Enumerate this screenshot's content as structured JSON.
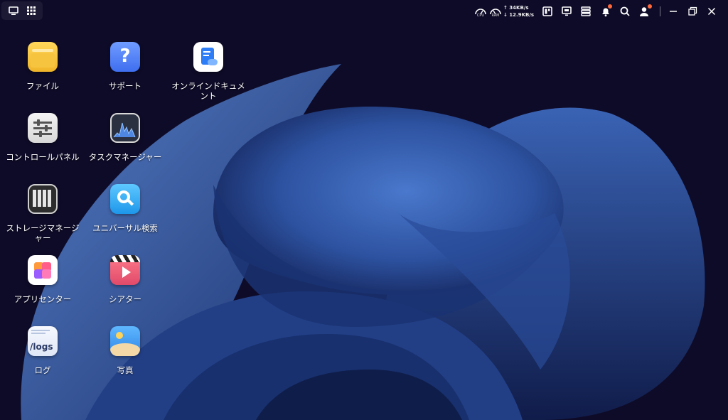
{
  "topbar": {
    "left_icons": [
      "desktop-icon",
      "apps-grid-icon"
    ],
    "meters": [
      {
        "label": "CPU",
        "icon": "cpu-gauge-icon"
      },
      {
        "label": "RAM",
        "icon": "ram-gauge-icon"
      }
    ],
    "network": {
      "upload": "↑ 34KB/s",
      "download": "↓ 12.9KB/s"
    },
    "right_icons": [
      "widget-icon",
      "monitor-icon",
      "server-list-icon",
      "bell-icon",
      "search-icon",
      "user-icon",
      "minimize-icon",
      "restore-icon",
      "close-icon"
    ],
    "notification_color": "#ff6a3d"
  },
  "desktop": {
    "items": [
      {
        "label": "ファイル",
        "icon": "folder-icon"
      },
      {
        "label": "サポート",
        "icon": "help-icon"
      },
      {
        "label": "オンラインドキュメント",
        "icon": "online-doc-icon"
      },
      {
        "label": "コントロールパネル",
        "icon": "control-panel-icon"
      },
      {
        "label": "タスクマネージャー",
        "icon": "task-manager-icon"
      },
      {
        "label": "ストレージマネージャー",
        "icon": "storage-manager-icon"
      },
      {
        "label": "ユニバーサル検索",
        "icon": "universal-search-icon"
      },
      {
        "label": "アプリセンター",
        "icon": "app-center-icon"
      },
      {
        "label": "シアター",
        "icon": "theater-icon"
      },
      {
        "label": "ログ",
        "icon": "logs-icon",
        "icon_text": "/logs"
      },
      {
        "label": "写真",
        "icon": "photos-icon"
      }
    ]
  },
  "theme": {
    "background": "#0d0a26",
    "wallpaper_blue": "#2f56a6"
  }
}
